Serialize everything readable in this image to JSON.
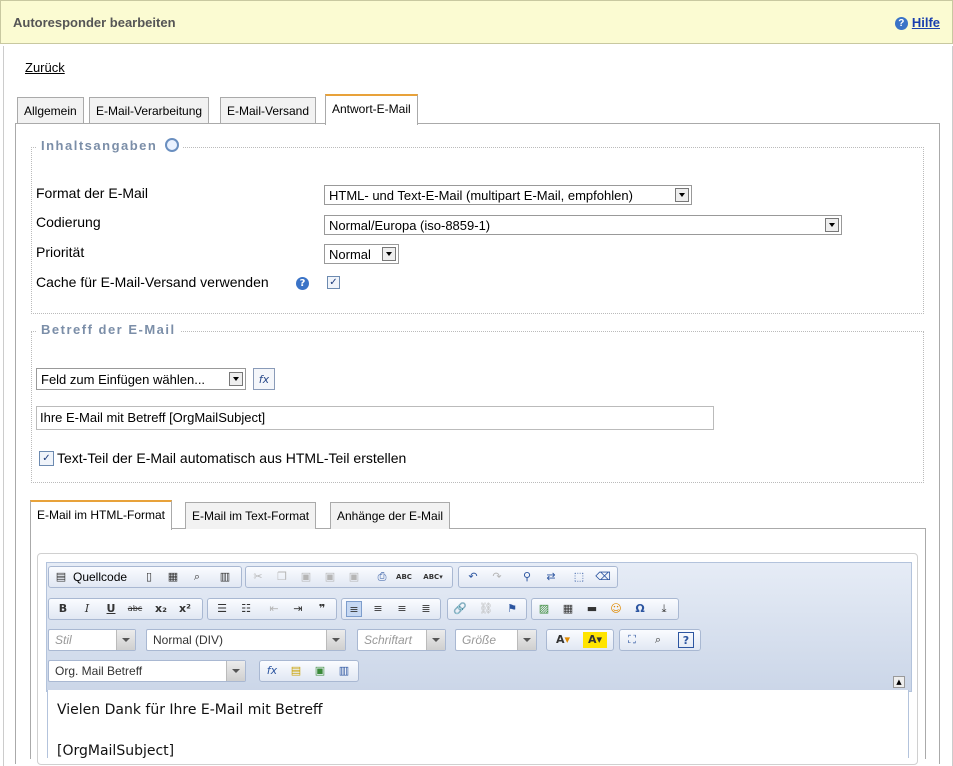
{
  "header": {
    "title": "Autoresponder bearbeiten",
    "help_label": "Hilfe"
  },
  "nav": {
    "back_label": "Zurück"
  },
  "tabs": [
    {
      "label": "Allgemein"
    },
    {
      "label": "E-Mail-Verarbeitung"
    },
    {
      "label": "E-Mail-Versand"
    },
    {
      "label": "Antwort-E-Mail"
    }
  ],
  "content_section": {
    "legend": "Inhaltsangaben",
    "format_label": "Format der E-Mail",
    "format_value": "HTML- und Text-E-Mail (multipart E-Mail, empfohlen)",
    "encoding_label": "Codierung",
    "encoding_value": "Normal/Europa (iso-8859-1)",
    "priority_label": "Priorität",
    "priority_value": "Normal",
    "cache_label": "Cache für E-Mail-Versand verwenden",
    "cache_checked": true
  },
  "subject_section": {
    "legend": "Betreff der E-Mail",
    "insert_field_value": "Feld zum Einfügen wählen...",
    "fx_label": "fx",
    "subject_value": "Ihre E-Mail mit Betreff [OrgMailSubject]",
    "autotext_label": "Text-Teil der E-Mail automatisch aus HTML-Teil erstellen",
    "autotext_checked": true
  },
  "body_tabs": [
    {
      "label": "E-Mail im HTML-Format"
    },
    {
      "label": "E-Mail im Text-Format"
    },
    {
      "label": "Anhänge der E-Mail"
    }
  ],
  "editor": {
    "source_label": "Quellcode",
    "style_combo": "Stil",
    "format_combo": "Normal (DIV)",
    "font_combo": "Schriftart",
    "size_combo": "Größe",
    "field_combo": "Org. Mail Betreff",
    "icons": {
      "bold": "B",
      "italic": "I",
      "underline": "U",
      "strike": "abc",
      "subscript": "x₂",
      "superscript": "x²",
      "quote": "❞",
      "special_char": "Ω",
      "help": "?",
      "fx": "fx",
      "spell": "ABC"
    },
    "body_line1": "Vielen Dank für Ihre E-Mail mit Betreff",
    "body_line2": "[OrgMailSubject]"
  }
}
